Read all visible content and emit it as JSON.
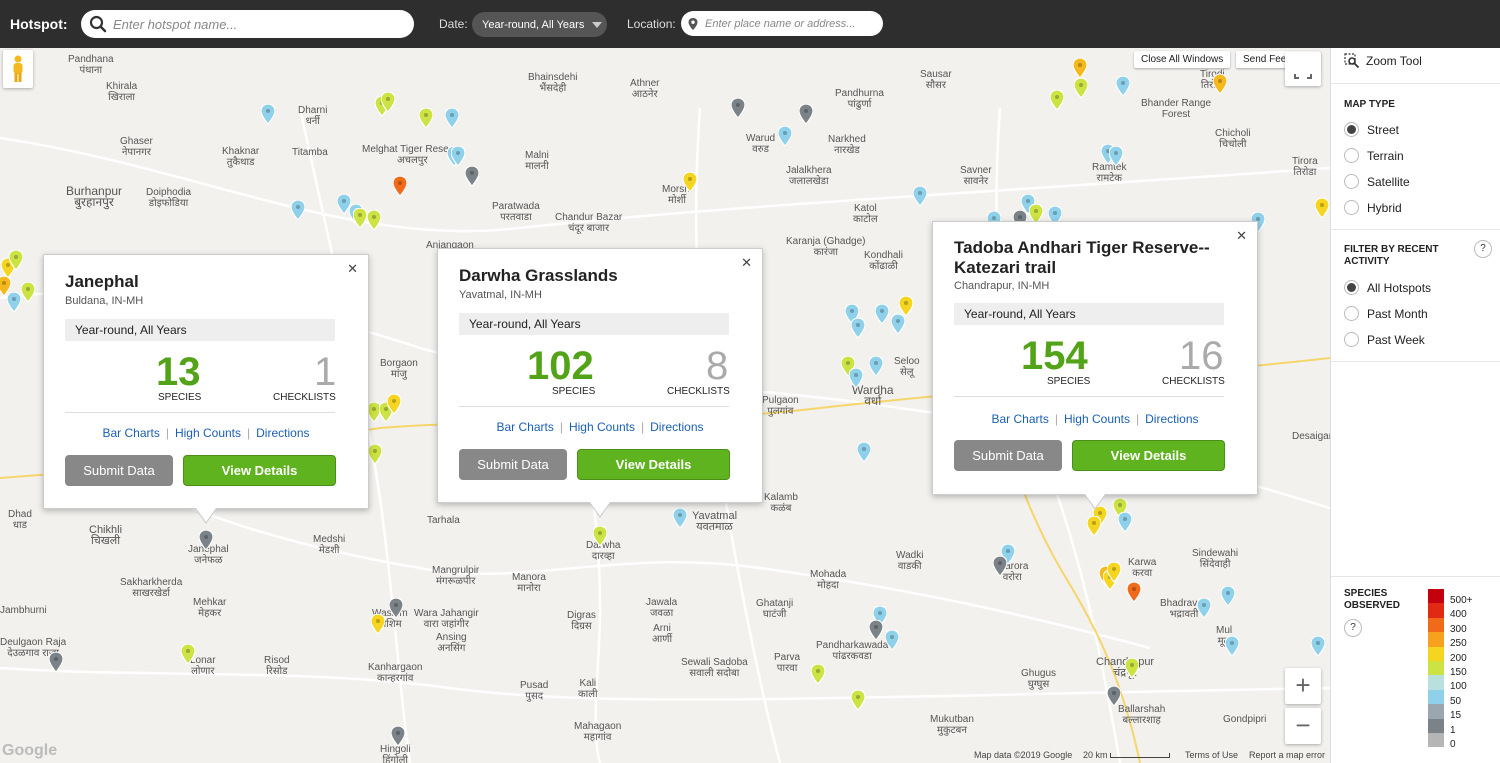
{
  "topbar": {
    "hotspot_label": "Hotspot:",
    "hotspot_placeholder": "Enter hotspot name...",
    "date_label": "Date:",
    "date_value": "Year-round, All Years",
    "location_label": "Location:",
    "location_placeholder": "Enter place name or address..."
  },
  "map": {
    "close_all": "Close All Windows",
    "send_feedback": "Send Feedback",
    "zoom_in": "+",
    "zoom_out": "−",
    "attribution": "Map data ©2019 Google",
    "scale": "20 km",
    "terms": "Terms of Use",
    "report": "Report a map error",
    "google": "Google"
  },
  "places": [
    {
      "en": "Pandhana",
      "local": "पंधाना"
    },
    {
      "en": "Khirala",
      "local": "खिराला"
    },
    {
      "en": "Dharni",
      "local": "धर्नी"
    },
    {
      "en": "Melghat Tiger Reserve",
      "local": "अचलपुर"
    },
    {
      "en": "Bhainsdehi",
      "local": "भैंसदेही"
    },
    {
      "en": "Athner",
      "local": "आठनेर"
    },
    {
      "en": "Pandhurna",
      "local": "पांढुर्णा"
    },
    {
      "en": "Sausar",
      "local": "सौसर"
    },
    {
      "en": "Tirodi",
      "local": "तिरोडी"
    },
    {
      "en": "Bhander Range Forest",
      "local": ""
    },
    {
      "en": "Ghaser",
      "local": "नेपानगर"
    },
    {
      "en": "Khaknar",
      "local": "तुकैथाड"
    },
    {
      "en": "Titamba",
      "local": ""
    },
    {
      "en": "Malni",
      "local": "मालनी"
    },
    {
      "en": "Warud",
      "local": "वरुड"
    },
    {
      "en": "Narkhed",
      "local": "नारखेड"
    },
    {
      "en": "Jalalkhera",
      "local": "जलालखेडा"
    },
    {
      "en": "Savner",
      "local": "सावनेर"
    },
    {
      "en": "Ramtek",
      "local": "रामटेक"
    },
    {
      "en": "Chicholi",
      "local": "चिचोली"
    },
    {
      "en": "Tirora",
      "local": "तिरोडा"
    },
    {
      "en": "Burhanpur",
      "local": "बुरहानपुर"
    },
    {
      "en": "Doiphodia",
      "local": "डोइफोडिया"
    },
    {
      "en": "Paratwada",
      "local": "परतवाडा"
    },
    {
      "en": "Chandur Bazar",
      "local": "चंदूर बाजार"
    },
    {
      "en": "Morshi",
      "local": "मोर्शी"
    },
    {
      "en": "Katol",
      "local": "काटोल"
    },
    {
      "en": "Karanja (Ghadge)",
      "local": "कारंजा"
    },
    {
      "en": "Kondhali",
      "local": "कोंढाळी"
    },
    {
      "en": "Anjangaon",
      "local": ""
    },
    {
      "en": "Borgaon",
      "local": "मांजु"
    },
    {
      "en": "Seloo",
      "local": "सेलू"
    },
    {
      "en": "Wardha",
      "local": "वर्धा"
    },
    {
      "en": "Pulgaon",
      "local": "पुलगांव"
    },
    {
      "en": "Kalamb",
      "local": "कळंब"
    },
    {
      "en": "Yavatmal",
      "local": "यवतमाळ"
    },
    {
      "en": "Desaiganj",
      "local": ""
    },
    {
      "en": "Dhad",
      "local": "धाड"
    },
    {
      "en": "Chikhli",
      "local": "चिखली"
    },
    {
      "en": "Janephal",
      "local": "जनेफळ"
    },
    {
      "en": "Medshi",
      "local": "मेडशी"
    },
    {
      "en": "Tarhala",
      "local": ""
    },
    {
      "en": "Mangrulpir",
      "local": "मंगरूळपीर"
    },
    {
      "en": "Darwha",
      "local": "दारव्हा"
    },
    {
      "en": "Wadki",
      "local": "वाडकी"
    },
    {
      "en": "Warora",
      "local": "वरोरा"
    },
    {
      "en": "Karwa",
      "local": "करवा"
    },
    {
      "en": "Sindewahi",
      "local": "सिंदेवाही"
    },
    {
      "en": "Sakharkherda",
      "local": "साखरखेर्डा"
    },
    {
      "en": "Mehkar",
      "local": "मेहकर"
    },
    {
      "en": "Manora",
      "local": "मानोरा"
    },
    {
      "en": "Mohada",
      "local": "मोहदा"
    },
    {
      "en": "Washim",
      "local": "वाशिम"
    },
    {
      "en": "Wara Jahangir",
      "local": "वारा जहांगीर"
    },
    {
      "en": "Digras",
      "local": "दिग्रस"
    },
    {
      "en": "Jawala",
      "local": "जवळा"
    },
    {
      "en": "Arni",
      "local": "आर्णी"
    },
    {
      "en": "Ghatanji",
      "local": "घाटंजी"
    },
    {
      "en": "Pandharkawada",
      "local": "पांढरकवडा"
    },
    {
      "en": "Bhadravati",
      "local": "भद्रावती"
    },
    {
      "en": "Mul",
      "local": "मूल"
    },
    {
      "en": "Jambhurni",
      "local": ""
    },
    {
      "en": "Deulgaon Raja",
      "local": "देउळगाव राजा"
    },
    {
      "en": "Lonar",
      "local": "लोणार"
    },
    {
      "en": "Risod",
      "local": "रिसोड"
    },
    {
      "en": "Ansing",
      "local": "अनसिंग"
    },
    {
      "en": "Kanhargaon",
      "local": "कान्हरगांव"
    },
    {
      "en": "Pusad",
      "local": "पुसद"
    },
    {
      "en": "Kali",
      "local": "काली"
    },
    {
      "en": "Sewali Sadoba",
      "local": "सवाली सदोबा"
    },
    {
      "en": "Parva",
      "local": "पारवा"
    },
    {
      "en": "Ghugus",
      "local": "घुग्घुस"
    },
    {
      "en": "Chandrapur",
      "local": "चंद्रपूर"
    },
    {
      "en": "Ballarshah",
      "local": "बल्लारशाह"
    },
    {
      "en": "Mahagaon",
      "local": "महागांव"
    },
    {
      "en": "Mukutban",
      "local": "मुकुटबन"
    },
    {
      "en": "Hingoli",
      "local": "हिंगोली"
    },
    {
      "en": "Gondpipri",
      "local": ""
    }
  ],
  "popups": [
    {
      "name": "Janephal",
      "region": "Buldana, IN-MH",
      "date": "Year-round, All Years",
      "species": "13",
      "species_label": "SPECIES",
      "checklists": "1",
      "checklists_label": "CHECKLISTS",
      "link_bar": "Bar Charts",
      "link_high": "High Counts",
      "link_dir": "Directions",
      "submit": "Submit Data",
      "view": "View Details"
    },
    {
      "name": "Darwha Grasslands",
      "region": "Yavatmal, IN-MH",
      "date": "Year-round, All Years",
      "species": "102",
      "species_label": "SPECIES",
      "checklists": "8",
      "checklists_label": "CHECKLISTS",
      "link_bar": "Bar Charts",
      "link_high": "High Counts",
      "link_dir": "Directions",
      "submit": "Submit Data",
      "view": "View Details"
    },
    {
      "name": "Tadoba Andhari Tiger Reserve--Katezari trail",
      "region": "Chandrapur, IN-MH",
      "date": "Year-round, All Years",
      "species": "154",
      "species_label": "SPECIES",
      "checklists": "16",
      "checklists_label": "CHECKLISTS",
      "link_bar": "Bar Charts",
      "link_high": "High Counts",
      "link_dir": "Directions",
      "submit": "Submit Data",
      "view": "View Details"
    }
  ],
  "sidebar": {
    "zoom_tool": "Zoom Tool",
    "map_type_title": "MAP TYPE",
    "map_types": [
      "Street",
      "Terrain",
      "Satellite",
      "Hybrid"
    ],
    "map_type_selected": "Street",
    "filter_title": "FILTER BY RECENT ACTIVITY",
    "filters": [
      "All Hotspots",
      "Past Month",
      "Past Week"
    ],
    "filter_selected": "All Hotspots",
    "help": "?",
    "legend_title": "SPECIES OBSERVED",
    "legend_labels": [
      "500+",
      "400",
      "300",
      "250",
      "200",
      "150",
      "100",
      "50",
      "15",
      "1",
      "0"
    ],
    "legend_colors": [
      "#c4000f",
      "#e02a13",
      "#f06a1a",
      "#f6a21f",
      "#f5d51f",
      "#cde243",
      "#b8e1de",
      "#8fd0ea",
      "#9aa6b0",
      "#7b8389",
      "#b5b5b5"
    ]
  }
}
